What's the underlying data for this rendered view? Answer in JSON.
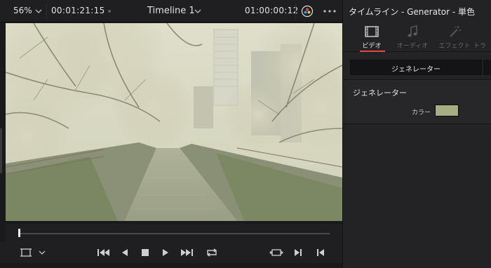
{
  "viewer": {
    "zoom": "56%",
    "source_timecode": "00:01:21:15",
    "timeline_name": "Timeline 1",
    "record_timecode": "01:00:00:12"
  },
  "inspector": {
    "title": "タイムライン - Generator - 単色",
    "tabs": [
      {
        "label": "ビデオ",
        "icon": "film-icon",
        "active": true
      },
      {
        "label": "オーディオ",
        "icon": "music-note-icon",
        "active": false
      },
      {
        "label": "エフェクト",
        "icon": "magic-wand-icon",
        "active": false
      },
      {
        "label": "トラ",
        "icon": "transition-icon",
        "active": false
      }
    ],
    "subtab": "ジェネレーター",
    "section_title": "ジェネレーター",
    "color_label": "カラー",
    "color_value": "#a8ad84"
  },
  "colors": {
    "accent": "#e8453c",
    "panel": "#232326",
    "viewer_bg": "#1a1a1c"
  }
}
